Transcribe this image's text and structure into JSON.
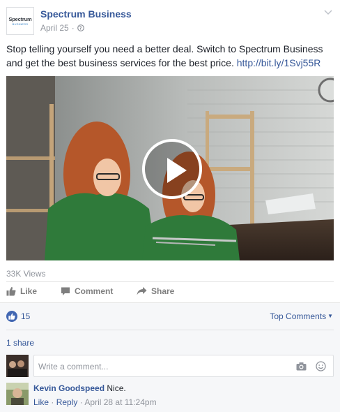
{
  "post": {
    "page_name": "Spectrum Business",
    "logo_line1": "Spectrum",
    "logo_line2": "BUSINESS",
    "date": "April 25",
    "meta_sep": "·",
    "text": "Stop telling yourself you need a better deal. Switch to Spectrum Business and get the best business services for the best price.",
    "link": "http://bit.ly/1Svj55R",
    "views": "33K Views"
  },
  "actions": {
    "like": "Like",
    "comment": "Comment",
    "share": "Share"
  },
  "feedback": {
    "like_count": "15",
    "top_comments": "Top Comments",
    "shares": "1 share",
    "composer_placeholder": "Write a comment..."
  },
  "comment": {
    "author": "Kevin Goodspeed",
    "text": "Nice.",
    "like": "Like",
    "reply": "Reply",
    "sep": "·",
    "timestamp": "April 28 at 11:24pm"
  },
  "colors": {
    "link": "#365899",
    "like_badge": "#4267b2",
    "muted": "#90949c"
  },
  "icons": [
    "globe-icon",
    "chevron-down-icon",
    "play-icon",
    "thumbs-up-icon",
    "comment-icon",
    "share-icon",
    "camera-icon",
    "smile-icon"
  ]
}
